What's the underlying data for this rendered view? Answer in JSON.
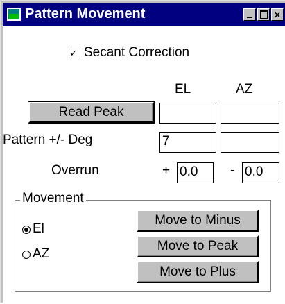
{
  "window": {
    "title": "Pattern Movement",
    "title_bg": "#000080",
    "window_bg": "#c0c0c0"
  },
  "secant": {
    "label": "Secant Correction",
    "checked": true
  },
  "columns": {
    "el": "EL",
    "az": "AZ"
  },
  "read_peak": {
    "button_label": "Read Peak",
    "el_value": "",
    "az_value": ""
  },
  "pattern": {
    "label": "Pattern +/- Deg",
    "el_value": "7",
    "az_value": ""
  },
  "overrun": {
    "label": "Overrun",
    "plus_sign": "+",
    "plus_value": "0.0",
    "minus_sign": "-",
    "minus_value": "0.0"
  },
  "movement": {
    "group_label": "Movement",
    "radios": [
      {
        "label": "El",
        "selected": true
      },
      {
        "label": "AZ",
        "selected": false
      }
    ],
    "buttons": [
      "Move to Minus",
      "Move to Peak",
      "Move to Plus"
    ]
  }
}
